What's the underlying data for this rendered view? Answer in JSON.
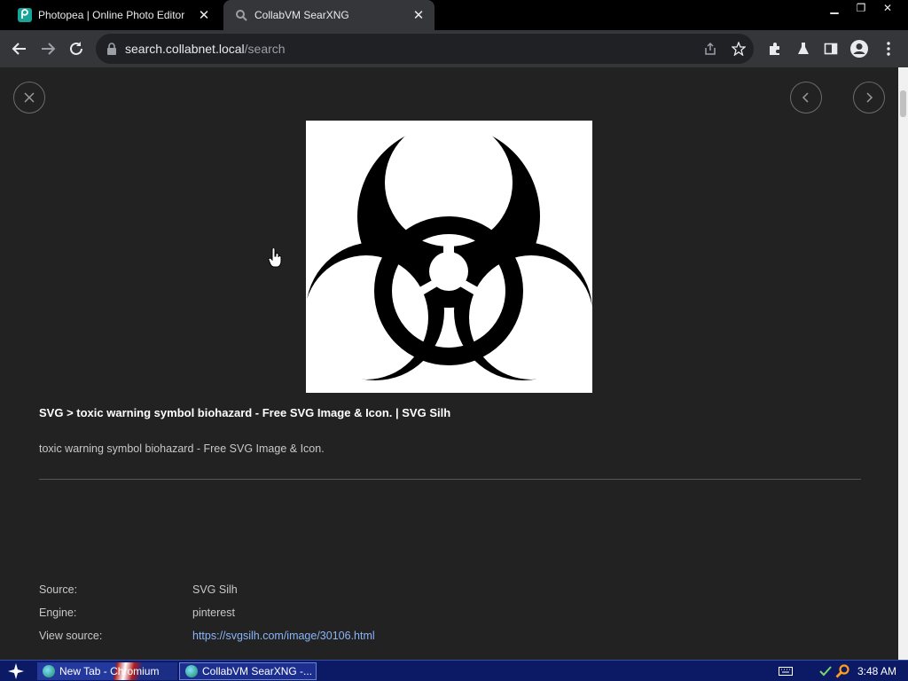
{
  "browser": {
    "tabs": [
      {
        "title": "Photopea | Online Photo Editor",
        "active": false
      },
      {
        "title": "CollabVM SearXNG",
        "active": true
      }
    ],
    "url_host": "search.collabnet.local",
    "url_path": "/search"
  },
  "detail": {
    "title": "SVG > toxic warning symbol biohazard - Free SVG Image & Icon. | SVG Silh",
    "description": "toxic warning symbol biohazard - Free SVG Image & Icon.",
    "meta": [
      {
        "label": "Source:",
        "value": "SVG Silh"
      },
      {
        "label": "Engine:",
        "value": "pinterest"
      },
      {
        "label": "View source:",
        "value": "https://svgsilh.com/image/30106.html"
      }
    ]
  },
  "taskbar": {
    "items": [
      {
        "label": "New Tab - Chromium"
      },
      {
        "label": "CollabVM SearXNG -..."
      }
    ],
    "clock": "3:48 AM"
  },
  "colors": {
    "page_bg": "#222222",
    "link": "#8ab4f8",
    "taskbar": "#0c1a66"
  }
}
